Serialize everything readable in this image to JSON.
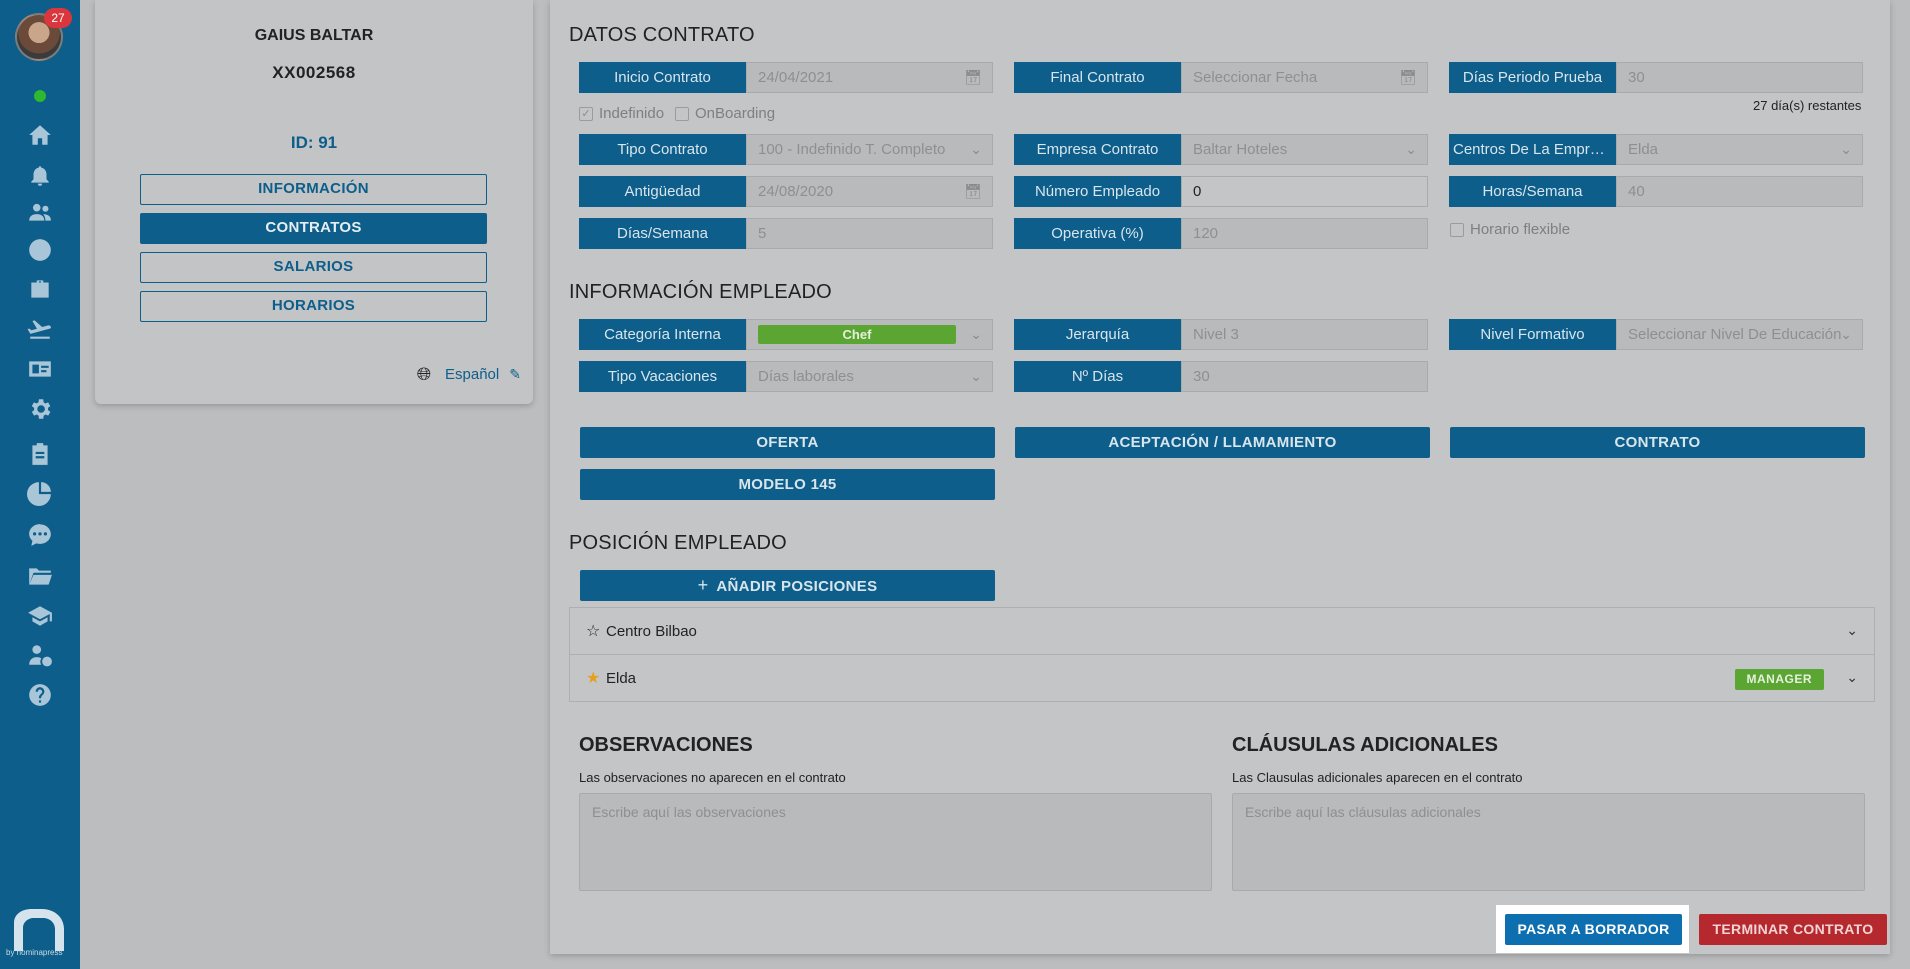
{
  "sidebar": {
    "notification_count": "27",
    "icons": [
      "home-icon",
      "bell-icon",
      "users-icon",
      "clock-icon",
      "briefcase-icon",
      "plane-icon",
      "id-card-icon",
      "gear-icon",
      "clipboard-icon",
      "pie-chart-icon",
      "chat-icon",
      "folder-icon",
      "graduation-cap-icon",
      "user-dollar-icon",
      "help-icon"
    ],
    "brand_text": "by nominapress"
  },
  "profile": {
    "name": "GAIUS BALTAR",
    "code": "XX002568",
    "id_label": "ID: 91",
    "tabs": [
      {
        "label": "INFORMACIÓN",
        "active": false
      },
      {
        "label": "CONTRATOS",
        "active": true
      },
      {
        "label": "SALARIOS",
        "active": false
      },
      {
        "label": "HORARIOS",
        "active": false
      }
    ],
    "language": "Español"
  },
  "contract": {
    "title": "DATOS CONTRATO",
    "inicio": {
      "label": "Inicio Contrato",
      "value": "24/04/2021"
    },
    "final": {
      "label": "Final Contrato",
      "placeholder": "Seleccionar Fecha"
    },
    "prueba": {
      "label": "Días Periodo Prueba",
      "value": "30"
    },
    "remaining": "27 día(s) restantes",
    "indefinido": {
      "label": "Indefinido",
      "checked": true
    },
    "onboarding": {
      "label": "OnBoarding",
      "checked": false
    },
    "tipo": {
      "label": "Tipo Contrato",
      "value": "100 - Indefinido T. Completo"
    },
    "empresa": {
      "label": "Empresa Contrato",
      "value": "Baltar Hoteles"
    },
    "centros": {
      "label": "Centros De La Empres...",
      "value": "Elda"
    },
    "antiguedad": {
      "label": "Antigüedad",
      "value": "24/08/2020"
    },
    "numero": {
      "label": "Número Empleado",
      "value": "0"
    },
    "horas": {
      "label": "Horas/Semana",
      "value": "40"
    },
    "dias": {
      "label": "Días/Semana",
      "value": "5"
    },
    "operativa": {
      "label": "Operativa (%)",
      "value": "120"
    },
    "flexible": {
      "label": "Horario flexible",
      "checked": false
    }
  },
  "employee": {
    "title": "INFORMACIÓN EMPLEADO",
    "categoria": {
      "label": "Categoría Interna",
      "value": "Chef"
    },
    "jerarquia": {
      "label": "Jerarquía",
      "value": "Nivel 3"
    },
    "nivel": {
      "label": "Nivel Formativo",
      "placeholder": "Seleccionar Nivel De Educación"
    },
    "vacaciones": {
      "label": "Tipo Vacaciones",
      "value": "Días laborales"
    },
    "ndias": {
      "label": "Nº Días",
      "value": "30"
    }
  },
  "documents": {
    "oferta": "OFERTA",
    "aceptacion": "ACEPTACIÓN / LLAMAMIENTO",
    "contrato": "CONTRATO",
    "modelo": "MODELO 145"
  },
  "positions": {
    "title": "POSICIÓN EMPLEADO",
    "add_label": "AÑADIR POSICIONES",
    "items": [
      {
        "name": "Centro Bilbao",
        "starred": false,
        "badge": ""
      },
      {
        "name": "Elda",
        "starred": true,
        "badge": "MANAGER"
      }
    ]
  },
  "observaciones": {
    "title": "OBSERVACIONES",
    "desc": "Las observaciones no aparecen en el contrato",
    "placeholder": "Escribe aquí las observaciones"
  },
  "clausulas": {
    "title": "CLÁUSULAS ADICIONALES",
    "desc": "Las Clausulas adicionales aparecen en el contrato",
    "placeholder": "Escribe aquí las cláusulas adicionales"
  },
  "actions": {
    "draft": "PASAR A BORRADOR",
    "terminate": "TERMINAR CONTRATO"
  },
  "colors": {
    "primary": "#0d5e8a",
    "success": "#5ba532",
    "danger": "#b5282e"
  }
}
